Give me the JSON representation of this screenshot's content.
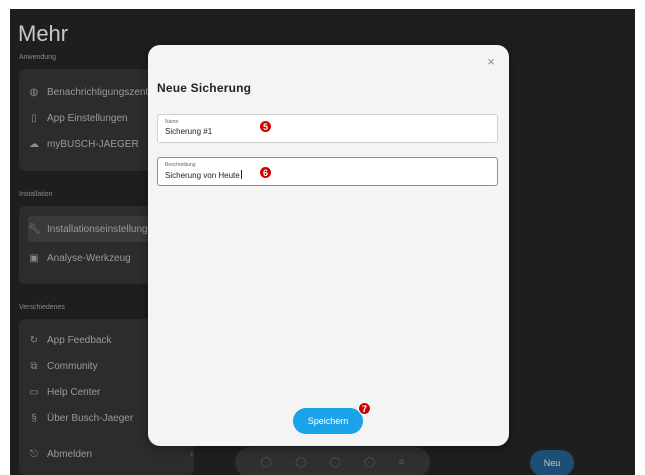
{
  "background": {
    "title": "Mehr",
    "sections": [
      {
        "label": "Anwendung",
        "items": [
          {
            "label": "Benachrichtigungszent",
            "icon": "bell-icon"
          },
          {
            "label": "App Einstellungen",
            "icon": "phone-icon"
          },
          {
            "label": "myBUSCH-JAEGER",
            "icon": "cloud-icon"
          }
        ]
      },
      {
        "label": "Installation",
        "items": [
          {
            "label": "Installationseinstellung",
            "icon": "wrench-icon"
          },
          {
            "label": "Analyse-Werkzeug",
            "icon": "chip-icon"
          }
        ]
      },
      {
        "label": "Verschiedenes",
        "items": [
          {
            "label": "App Feedback",
            "icon": "feedback-icon"
          },
          {
            "label": "Community",
            "icon": "community-icon"
          },
          {
            "label": "Help Center",
            "icon": "help-icon"
          },
          {
            "label": "Über Busch-Jaeger",
            "icon": "info-icon"
          },
          {
            "label": "Abmelden",
            "icon": "logout-icon"
          }
        ]
      }
    ],
    "neu_label": "Neu"
  },
  "modal": {
    "title": "Neue Sicherung",
    "fields": [
      {
        "label": "Name",
        "value": "Sicherung #1",
        "badge": "5"
      },
      {
        "label": "Beschreibung",
        "value": "Sicherung von Heute",
        "badge": "6"
      }
    ],
    "save_label": "Speichern",
    "save_badge": "7",
    "close_glyph": "×"
  },
  "colors": {
    "accent": "#1aa3e8",
    "badge": "#d10000"
  }
}
